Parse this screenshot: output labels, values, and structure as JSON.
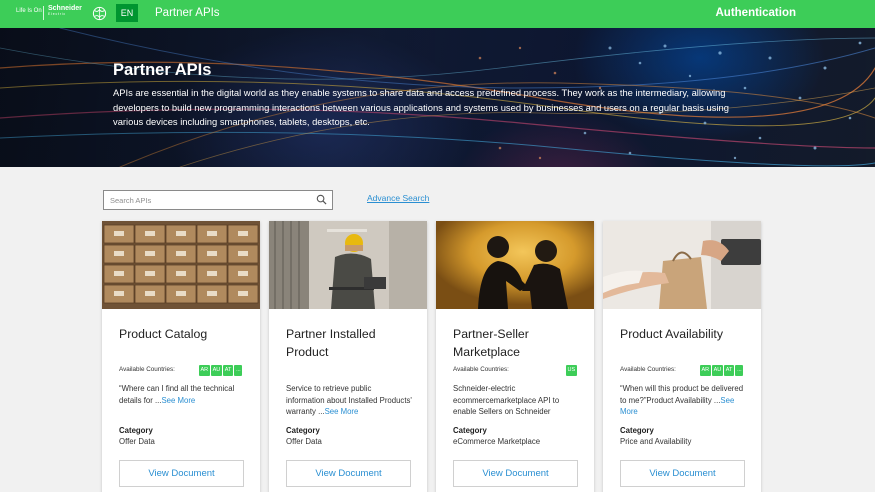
{
  "header": {
    "tagline": "Life Is On",
    "brand_name": "Schneider",
    "brand_sub": "Electric",
    "lang": "EN",
    "title": "Partner APIs",
    "auth": "Authentication",
    "bar_color": "#3dcd58"
  },
  "hero": {
    "title": "Partner APIs",
    "text": "APIs are essential in the digital world as they enable systems to share data and access predefined process. They work as the intermediary, allowing developers to build new programming interactions between various applications and systems used by businesses and users on a regular basis using various devices including smartphones, tablets, desktops, etc."
  },
  "search": {
    "placeholder": "Search APIs",
    "icon": "search-icon",
    "advance_label": "Advance Search"
  },
  "cards": [
    {
      "title": "Product Catalog",
      "avail_label": "Available Countries:",
      "countries": [
        "AR",
        "AU",
        "AT",
        "..."
      ],
      "desc": "“Where can I find all the technical details for ...",
      "see_more": "See More",
      "category_label": "Category",
      "category": "Offer Data",
      "button": "View Document",
      "image": "warehouse-boxes"
    },
    {
      "title": "Partner Installed Product",
      "avail_label": "",
      "countries": [],
      "desc": "Service to retrieve public information about Installed Products' warranty ...",
      "see_more": "See More",
      "category_label": "Category",
      "category": "Offer Data",
      "button": "View Document",
      "image": "engineer-laptop"
    },
    {
      "title": "Partner-Seller Marketplace",
      "avail_label": "Available Countries:",
      "countries": [
        "US"
      ],
      "desc": "Schneider-electric ecommercemarketplace API to enable Sellers on Schneider",
      "see_more": "",
      "category_label": "Category",
      "category": "eCommerce Marketplace",
      "button": "View Document",
      "image": "handshake"
    },
    {
      "title": "Product Availability",
      "avail_label": "Available Countries:",
      "countries": [
        "AR",
        "AU",
        "AT",
        "..."
      ],
      "desc": "“When will this product be delivered to me?”Product Availability ...",
      "see_more": "See More",
      "category_label": "Category",
      "category": "Price and Availability",
      "button": "View Document",
      "image": "shopping-delivery"
    }
  ],
  "colors": {
    "accent_green": "#3dcd58",
    "link_blue": "#2a8fd2",
    "lang_green": "#009530"
  }
}
